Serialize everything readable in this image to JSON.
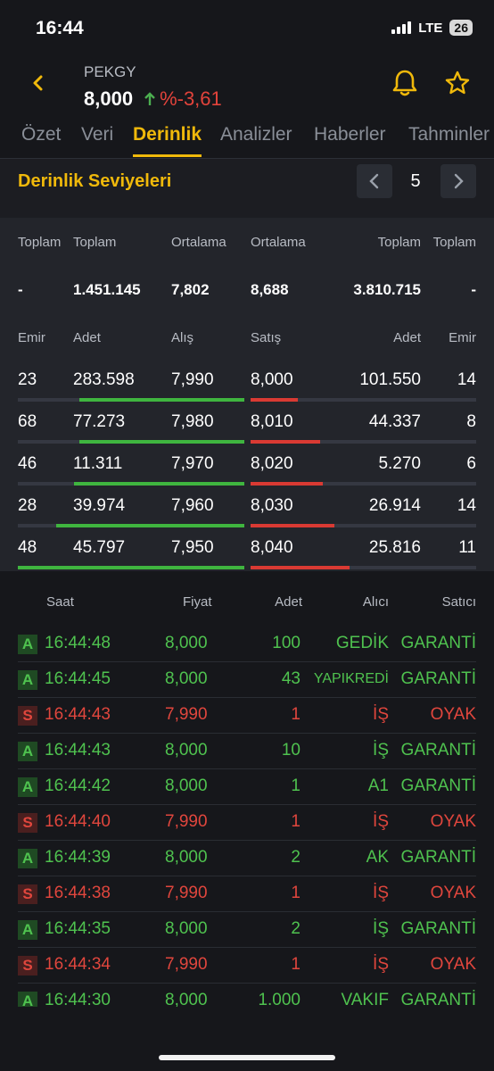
{
  "status": {
    "time": "16:44",
    "network": "LTE",
    "battery": "26"
  },
  "header": {
    "symbol": "PEKGY",
    "price": "8,000",
    "change": "%-3,61"
  },
  "tabs": [
    {
      "label": "Özet"
    },
    {
      "label": "Veri"
    },
    {
      "label": "Derinlik"
    },
    {
      "label": "Analizler"
    },
    {
      "label": "Haberler"
    },
    {
      "label": "Tahminler"
    }
  ],
  "depth": {
    "title": "Derinlik Seviyeleri",
    "levels": "5",
    "summary_labels": [
      "Toplam",
      "Toplam",
      "Ortalama",
      "Ortalama",
      "Toplam",
      "Toplam"
    ],
    "summary_values": [
      "-",
      "1.451.145",
      "7,802",
      "8,688",
      "3.810.715",
      "-"
    ],
    "col_labels": [
      "Emir",
      "Adet",
      "Alış",
      "Satış",
      "Adet",
      "Emir"
    ],
    "rows": [
      {
        "bid_orders": "23",
        "bid_qty": "283.598",
        "bid": "7,990",
        "ask": "8,000",
        "ask_qty": "101.550",
        "ask_orders": "14",
        "bid_fill": 0.73,
        "ask_fill": 0.21
      },
      {
        "bid_orders": "68",
        "bid_qty": "77.273",
        "bid": "7,980",
        "ask": "8,010",
        "ask_qty": "44.337",
        "ask_orders": "8",
        "bid_fill": 0.73,
        "ask_fill": 0.31
      },
      {
        "bid_orders": "46",
        "bid_qty": "11.311",
        "bid": "7,970",
        "ask": "8,020",
        "ask_qty": "5.270",
        "ask_orders": "6",
        "bid_fill": 0.75,
        "ask_fill": 0.32
      },
      {
        "bid_orders": "28",
        "bid_qty": "39.974",
        "bid": "7,960",
        "ask": "8,030",
        "ask_qty": "26.914",
        "ask_orders": "14",
        "bid_fill": 0.83,
        "ask_fill": 0.37
      },
      {
        "bid_orders": "48",
        "bid_qty": "45.797",
        "bid": "7,950",
        "ask": "8,040",
        "ask_qty": "25.816",
        "ask_orders": "11",
        "bid_fill": 1.0,
        "ask_fill": 0.44
      }
    ]
  },
  "trades": {
    "headers": [
      "Saat",
      "Fiyat",
      "Adet",
      "Alıcı",
      "Satıcı"
    ],
    "rows": [
      {
        "side": "A",
        "time": "16:44:48",
        "price": "8,000",
        "qty": "100",
        "buyer": "GEDİK",
        "seller": "GARANTİ"
      },
      {
        "side": "A",
        "time": "16:44:45",
        "price": "8,000",
        "qty": "43",
        "buyer": "YAPIKREDİ",
        "seller": "GARANTİ"
      },
      {
        "side": "S",
        "time": "16:44:43",
        "price": "7,990",
        "qty": "1",
        "buyer": "İŞ",
        "seller": "OYAK"
      },
      {
        "side": "A",
        "time": "16:44:43",
        "price": "8,000",
        "qty": "10",
        "buyer": "İŞ",
        "seller": "GARANTİ"
      },
      {
        "side": "A",
        "time": "16:44:42",
        "price": "8,000",
        "qty": "1",
        "buyer": "A1",
        "seller": "GARANTİ"
      },
      {
        "side": "S",
        "time": "16:44:40",
        "price": "7,990",
        "qty": "1",
        "buyer": "İŞ",
        "seller": "OYAK"
      },
      {
        "side": "A",
        "time": "16:44:39",
        "price": "8,000",
        "qty": "2",
        "buyer": "AK",
        "seller": "GARANTİ"
      },
      {
        "side": "S",
        "time": "16:44:38",
        "price": "7,990",
        "qty": "1",
        "buyer": "İŞ",
        "seller": "OYAK"
      },
      {
        "side": "A",
        "time": "16:44:35",
        "price": "8,000",
        "qty": "2",
        "buyer": "İŞ",
        "seller": "GARANTİ"
      },
      {
        "side": "S",
        "time": "16:44:34",
        "price": "7,990",
        "qty": "1",
        "buyer": "İŞ",
        "seller": "OYAK"
      },
      {
        "side": "A",
        "time": "16:44:30",
        "price": "8,000",
        "qty": "1.000",
        "buyer": "VAKIF",
        "seller": "GARANTİ"
      }
    ]
  },
  "colors": {
    "accent": "#f0b90b",
    "buy": "#4fc24f",
    "sell": "#e0463d"
  },
  "icons": {
    "back": "chevron-left-icon",
    "bell": "bell-icon",
    "star": "star-icon",
    "prev": "chevron-left-icon",
    "next": "chevron-right-icon"
  }
}
